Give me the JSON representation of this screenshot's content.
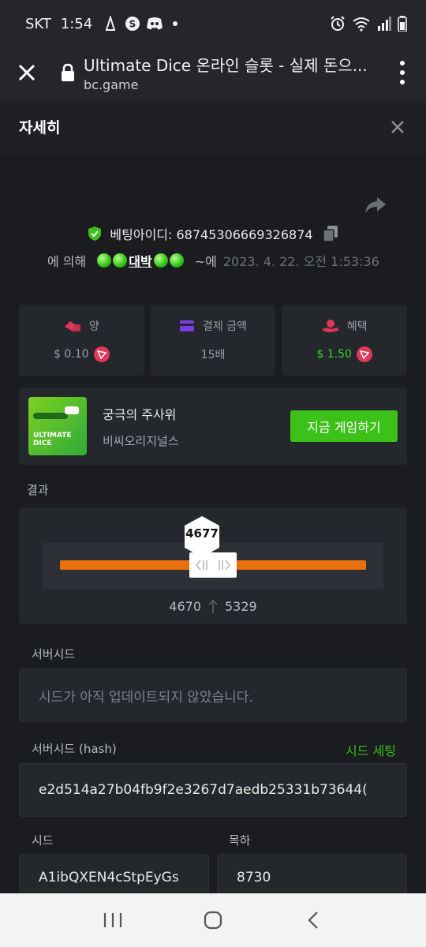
{
  "status_bar": {
    "carrier": "SKT",
    "time": "1:54",
    "icons": [
      "notification-icon",
      "s-app-icon",
      "discord-icon"
    ]
  },
  "browser": {
    "page_title": "Ultimate Dice 온라인 슬롯 - 실제 돈으...",
    "url": "bc.game"
  },
  "modal": {
    "title": "자세히"
  },
  "bet": {
    "id_label": "베팅아이디: 68745306669326874",
    "by_label": "에 의해",
    "username": "대박",
    "at_label": "~에",
    "timestamp": "2023. 4. 22. 오전 1:53:36"
  },
  "stats": [
    {
      "label": "양",
      "value": "$ 0.10",
      "icon": "bet-icon",
      "color": "#e2365a"
    },
    {
      "label": "결제 금액",
      "value": "15배",
      "icon": "card-icon",
      "color": "#7b3fe4"
    },
    {
      "label": "혜택",
      "value": "$ 1.50",
      "icon": "profit-icon",
      "color": "#e2365a"
    }
  ],
  "game": {
    "thumb_text": "ULTIMATE DICE",
    "name": "궁극의 주사위",
    "provider": "비씨오리지널스",
    "play_label": "지금 게임하기"
  },
  "result": {
    "section_label": "결과",
    "value": "4677",
    "range_low": "4670",
    "range_high": "5329"
  },
  "server_seed": {
    "label": "서버시드",
    "value": "시드가 아직 업데이트되지 않았습니다."
  },
  "server_seed_hash": {
    "label": "서버시드 (hash)",
    "action": "시드 세팅",
    "value": "e2d514a27b04fb9f2e3267d7aedb25331b73644("
  },
  "client_seed": {
    "label": "시드",
    "value": "A1ibQXEN4cStpEyGs"
  },
  "nonce": {
    "label": "목하",
    "value": "8730"
  },
  "colors": {
    "accent_green": "#3bc117",
    "slider_orange": "#e8710d",
    "background": "#1a1c1f",
    "card": "#24272c"
  }
}
